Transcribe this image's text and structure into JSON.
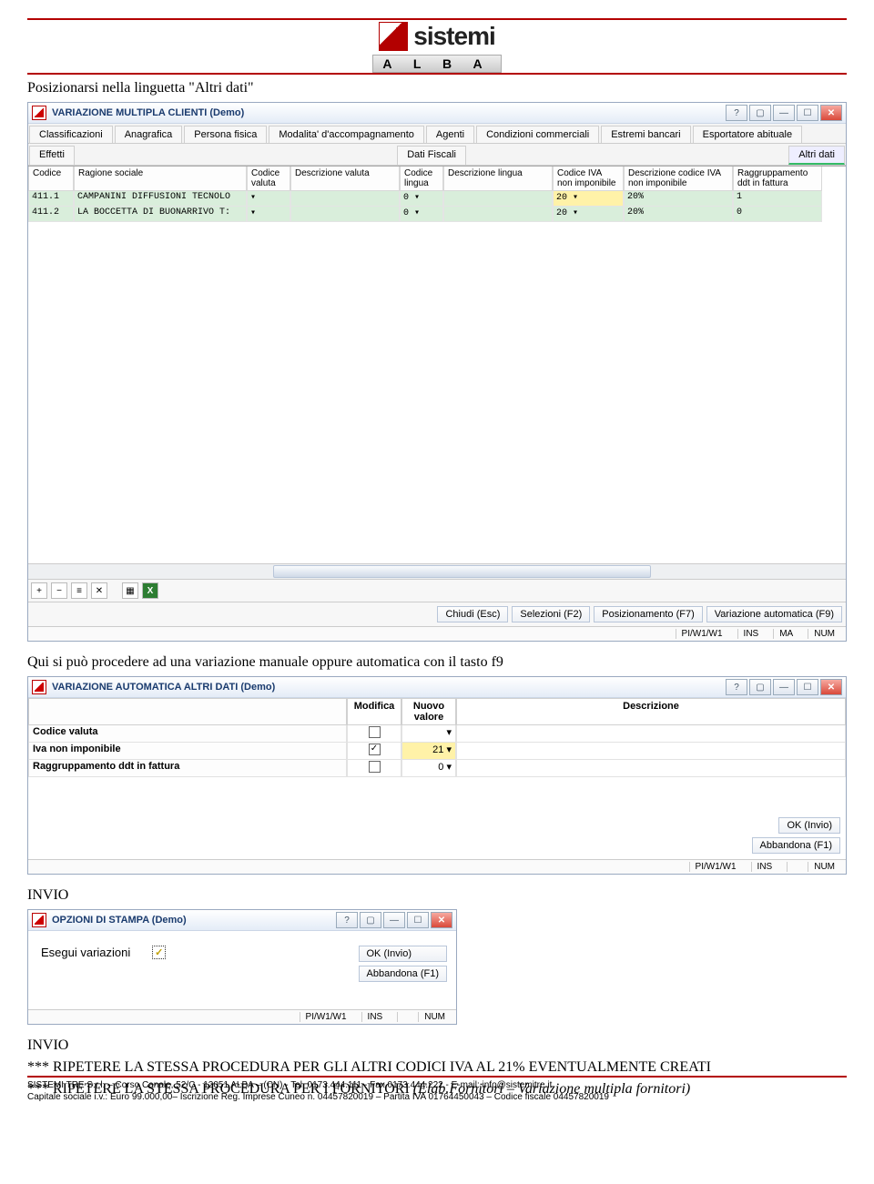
{
  "logo": {
    "brand": "sistemi",
    "sub": "A L B A"
  },
  "doc": {
    "line1": "Posizionarsi nella linguetta \"Altri dati\"",
    "line2": "Qui si può procedere ad una variazione manuale oppure automatica con il tasto f9",
    "invio1": "INVIO",
    "invio2": "INVIO",
    "rip1": "*** RIPETERE LA STESSA PROCEDURA PER GLI ALTRI CODICI IVA AL 21% EVENTUALMENTE CREATI",
    "rip2a": "*** RIPETERE LA STESSA PROCEDURA PER I FORNITORI ",
    "rip2b": "(Elab.Fornitori – Variazione multipla fornitori)"
  },
  "win1": {
    "title": "VARIAZIONE MULTIPLA CLIENTI   (Demo)",
    "tabs_top": [
      "Classificazioni",
      "Anagrafica",
      "Persona fisica",
      "Modalita' d'accompagnamento",
      "Agenti",
      "Condizioni commerciali",
      "Estremi bancari",
      "Esportatore abituale"
    ],
    "tabs_row2_left": "Effetti",
    "tabs_row2_mid": "Dati Fiscali",
    "tabs_row2_right": "Altri dati",
    "cols": [
      "Codice",
      "Ragione sociale",
      "Codice valuta",
      "Descrizione valuta",
      "Codice lingua",
      "Descrizione lingua",
      "Codice IVA non imponibile",
      "Descrizione codice IVA non imponibile",
      "Raggruppamento ddt in fattura"
    ],
    "rows": [
      {
        "codice": "411.1",
        "ragione": "CAMPANINI DIFFUSIONI TECNOLO",
        "cval": "",
        "dval": "",
        "cling": "0",
        "dling": "",
        "ciiva": "20",
        "diiva": "20%",
        "rag": "1",
        "hi": true
      },
      {
        "codice": "411.2",
        "ragione": "LA BOCCETTA DI BUONARRIVO T:",
        "cval": "",
        "dval": "",
        "cling": "0",
        "dling": "",
        "ciiva": "20",
        "diiva": "20%",
        "rag": "0",
        "hi": false
      }
    ],
    "buttons": [
      "Chiudi (Esc)",
      "Selezioni (F2)",
      "Posizionamento (F7)",
      "Variazione automatica (F9)"
    ],
    "status": [
      "PI/W1/W1",
      "INS",
      "MA",
      "NUM"
    ]
  },
  "win2": {
    "title": "VARIAZIONE AUTOMATICA ALTRI DATI   (Demo)",
    "head": [
      "",
      "Modifica",
      "Nuovo valore",
      "Descrizione"
    ],
    "rows": [
      {
        "lbl": "Codice valuta",
        "mod": false,
        "val": "",
        "hi": false
      },
      {
        "lbl": "Iva non imponibile",
        "mod": true,
        "val": "21",
        "hi": true
      },
      {
        "lbl": "Raggruppamento ddt in fattura",
        "mod": false,
        "val": "0",
        "hi": false
      }
    ],
    "ok": "OK (Invio)",
    "abb": "Abbandona (F1)",
    "status": [
      "PI/W1/W1",
      "INS",
      "",
      "NUM"
    ]
  },
  "win3": {
    "title": "OPZIONI DI STAMPA   (Demo)",
    "label": "Esegui variazioni",
    "ok": "OK (Invio)",
    "abb": "Abbandona (F1)",
    "status": [
      "PI/W1/W1",
      "INS",
      "",
      "NUM"
    ]
  },
  "footer": {
    "l1": "SISTEMI TRE S.r.l. – Corso Canale, 52/C - 12051 ALBA – (CN) - Tel. 0173.444.111 - Fax 0173.444.222 - E-mail: info@sistemitre.it",
    "l2": "Capitale sociale i.v.: Euro 99.000,00– Iscrizione Reg. Imprese Cuneo n. 04457820019 – Partita IVA 01764450043 – Codice fiscale 04457820019"
  }
}
